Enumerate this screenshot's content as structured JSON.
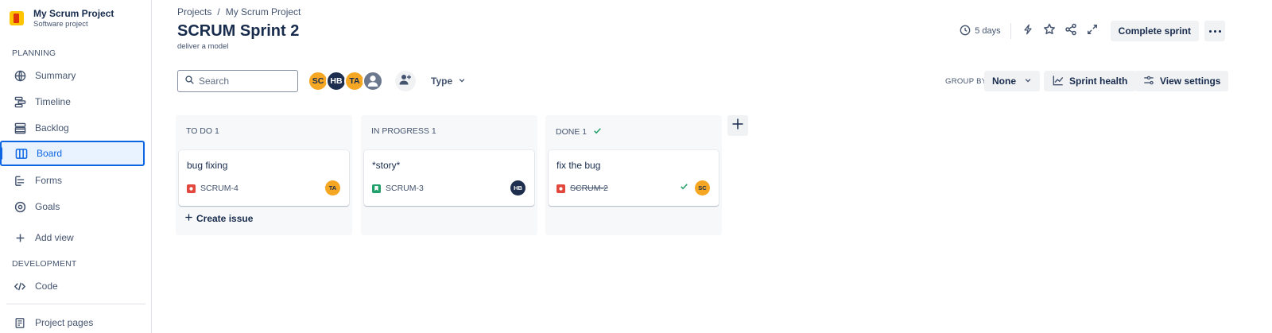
{
  "sidebar": {
    "project_name": "My Scrum Project",
    "project_type": "Software project",
    "planning_label": "PLANNING",
    "development_label": "DEVELOPMENT",
    "items": [
      {
        "label": "Summary",
        "icon": "globe-icon"
      },
      {
        "label": "Timeline",
        "icon": "timeline-icon"
      },
      {
        "label": "Backlog",
        "icon": "backlog-icon"
      },
      {
        "label": "Board",
        "icon": "board-icon",
        "active": true
      },
      {
        "label": "Forms",
        "icon": "forms-icon"
      },
      {
        "label": "Goals",
        "icon": "goals-icon"
      },
      {
        "label": "Add view",
        "icon": "plus-icon"
      }
    ],
    "dev_items": [
      {
        "label": "Code",
        "icon": "code-icon"
      }
    ],
    "footer_items": [
      {
        "label": "Project pages",
        "icon": "page-icon"
      }
    ]
  },
  "header": {
    "breadcrumb": [
      "Projects",
      "/",
      "My Scrum Project"
    ],
    "title": "SCRUM Sprint 2",
    "goal": "deliver a model",
    "days_remaining": "5 days",
    "complete_label": "Complete sprint"
  },
  "filters": {
    "search_placeholder": "Search",
    "avatars": [
      {
        "initials": "SC",
        "bg": "#f5a623",
        "fg": "#172b4d"
      },
      {
        "initials": "HB",
        "bg": "#1d2e4f",
        "fg": "#ffffff"
      },
      {
        "initials": "TA",
        "bg": "#f5a623",
        "fg": "#172b4d"
      }
    ],
    "type_label": "Type",
    "group_by_label": "GROUP BY",
    "group_by_value": "None",
    "sprint_health_label": "Sprint health",
    "view_settings_label": "View settings"
  },
  "board": {
    "columns": [
      {
        "title": "TO DO 1",
        "cards": [
          {
            "title": "bug fixing",
            "key": "SCRUM-4",
            "type": "bug",
            "assignee": "TA",
            "assignee_bg": "#f5a623",
            "assignee_fg": "#172b4d"
          }
        ],
        "create_label": "Create issue"
      },
      {
        "title": "IN PROGRESS 1",
        "cards": [
          {
            "title": "*story*",
            "key": "SCRUM-3",
            "type": "story",
            "assignee": "HB",
            "assignee_bg": "#1d2e4f",
            "assignee_fg": "#ffffff"
          }
        ]
      },
      {
        "title": "DONE 1",
        "cards": [
          {
            "title": "fix the bug",
            "key": "SCRUM-2",
            "type": "bug",
            "assignee": "SC",
            "assignee_bg": "#f5a623",
            "assignee_fg": "#172b4d",
            "done": true
          }
        ]
      }
    ]
  },
  "colors": {
    "accent": "#0c66e4",
    "bug": "#e2483d",
    "story": "#22a06b",
    "done_check": "#22a06b"
  }
}
